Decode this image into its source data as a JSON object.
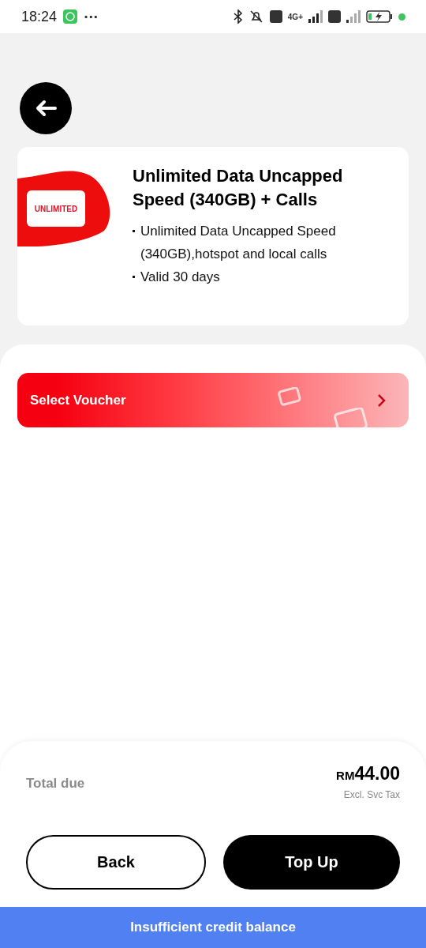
{
  "status_bar": {
    "time": "18:24",
    "network": "4G+",
    "more": "···"
  },
  "plan": {
    "badge": "UNLIMITED",
    "title": "Unlimited Data Uncapped Speed (340GB) + Calls",
    "bullets": [
      "Unlimited Data Uncapped Speed (340GB),hotspot and local calls",
      "Valid 30 days"
    ]
  },
  "voucher": {
    "label": "Select Voucher"
  },
  "total": {
    "label": "Total due",
    "currency": "RM",
    "amount": "44.00",
    "note": "Excl. Svc Tax"
  },
  "buttons": [
    {
      "label": "Back",
      "kind": "outline"
    },
    {
      "label": "Top Up",
      "kind": "filled"
    }
  ],
  "banner": {
    "message": "Insufficient credit balance"
  }
}
